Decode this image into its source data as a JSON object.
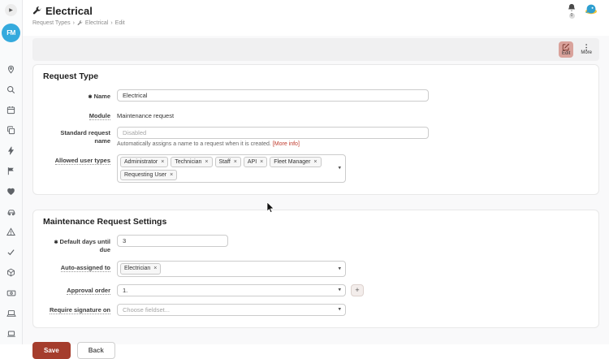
{
  "app": {
    "logo_text": "FM"
  },
  "sidebar": {
    "icons": [
      "location-pin",
      "search",
      "calendar",
      "copy",
      "bolt",
      "flag",
      "heart",
      "car",
      "warning-triangle",
      "check",
      "cube",
      "billing",
      "laptop",
      "device"
    ]
  },
  "header": {
    "title": "Electrical",
    "breadcrumb": [
      {
        "label": "Request Types"
      },
      {
        "label": "Electrical"
      },
      {
        "label": "Edit"
      }
    ],
    "separator": "›",
    "notifications_count": "0"
  },
  "toolbar": {
    "edit_label": "Edit",
    "more_label": "More"
  },
  "request_type_card": {
    "title": "Request Type",
    "fields": {
      "name": {
        "label": "Name",
        "value": "Electrical"
      },
      "module": {
        "label": "Module",
        "value": "Maintenance request"
      },
      "standard_request_name": {
        "label": "Standard request name",
        "placeholder": "Disabled",
        "help": "Automatically assigns a name to a request when it is created.",
        "help_link": "[More info]"
      },
      "allowed_user_types": {
        "label": "Allowed user types",
        "tags": [
          "Administrator",
          "Technician",
          "Staff",
          "API",
          "Fleet Manager",
          "Requesting User"
        ]
      }
    }
  },
  "settings_card": {
    "title": "Maintenance Request Settings",
    "fields": {
      "default_days": {
        "label": "Default days until due",
        "value": "3"
      },
      "auto_assigned": {
        "label": "Auto-assigned to",
        "tags": [
          "Electrician"
        ]
      },
      "approval_order": {
        "label": "Approval order",
        "value": "1."
      },
      "require_signature": {
        "label": "Require signature on",
        "placeholder": "Choose fieldset..."
      }
    }
  },
  "actions": {
    "save": "Save",
    "back": "Back"
  },
  "glyphs": {
    "required": "✱",
    "caret": "▾",
    "tag_remove": "×",
    "more": "⋮",
    "expand": "▶",
    "plus": "+"
  },
  "colors": {
    "save_bg": "#a53d2d",
    "edit_bg": "#d9a29b",
    "link_red": "#c0392b",
    "logo_blue": "#35aadd"
  }
}
